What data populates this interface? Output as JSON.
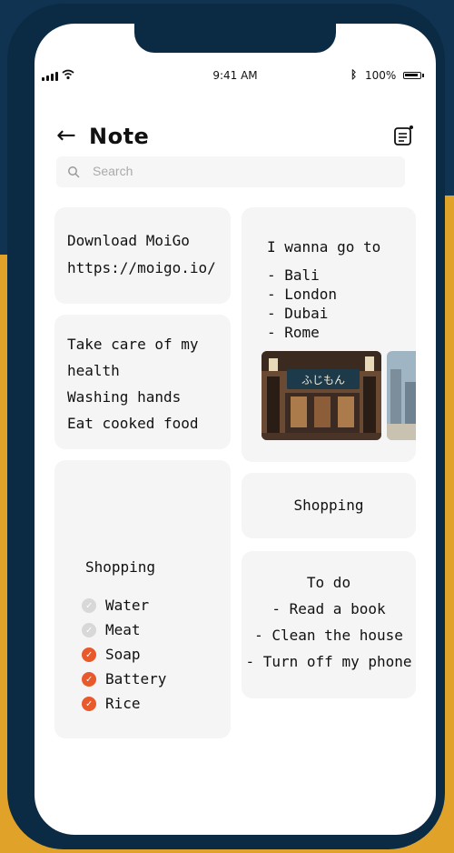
{
  "status_bar": {
    "time": "9:41 AM",
    "battery": "100%"
  },
  "header": {
    "title": "Note"
  },
  "search": {
    "placeholder": "Search"
  },
  "notes": {
    "download": {
      "line1": "Download MoiGo",
      "line2": "https://moigo.io/"
    },
    "health": {
      "lines": [
        "Take care of my",
        "health",
        "Washing hands",
        "Eat cooked food"
      ]
    },
    "shopping_list": {
      "title": "Shopping",
      "items": [
        {
          "label": "Water",
          "checked": false
        },
        {
          "label": "Meat",
          "checked": false
        },
        {
          "label": "Soap",
          "checked": true
        },
        {
          "label": "Battery",
          "checked": true
        },
        {
          "label": "Rice",
          "checked": true
        }
      ]
    },
    "travel": {
      "title": "I wanna go to",
      "destinations": [
        "- Bali",
        "- London",
        "- Dubai",
        "- Rome"
      ],
      "sign_text": "ふじもん"
    },
    "shopping": {
      "title": "Shopping"
    },
    "todo": {
      "lines": [
        "To do",
        "- Read a book",
        "- Clean the house",
        "- Turn off my phone"
      ]
    }
  },
  "colors": {
    "accent": "#e85a2b",
    "card": "#f5f5f5",
    "frame": "#0b2a44",
    "background_band": "#e1a229"
  }
}
